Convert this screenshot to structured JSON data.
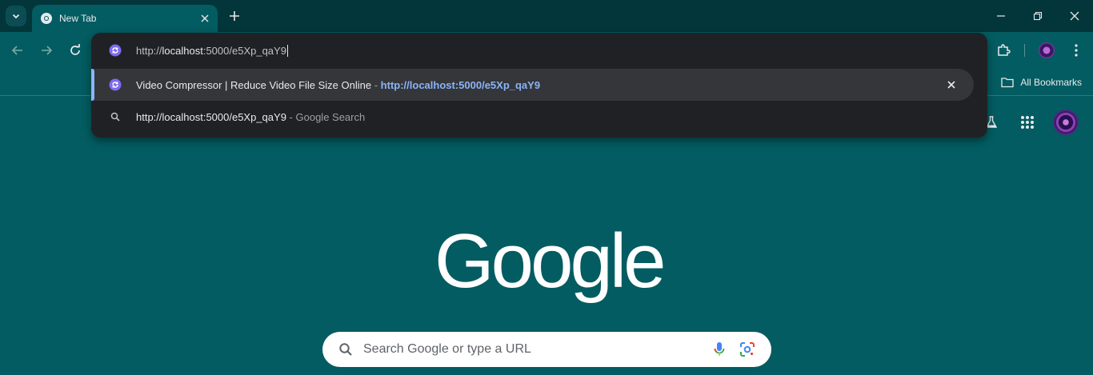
{
  "tab": {
    "title": "New Tab"
  },
  "omnibox": {
    "input_prefix": "http://",
    "input_host": "localhost",
    "input_rest": ":5000/e5Xp_qaY9",
    "suggestion_title": "Video Compressor | Reduce Video File Size Online",
    "suggestion_sep": " - ",
    "suggestion_url": "http://localhost:5000/e5Xp_qaY9",
    "search_query": "http://localhost:5000/e5Xp_qaY9",
    "search_sep": " - ",
    "search_suffix": "Google Search"
  },
  "bookmarks": {
    "all_label": "All Bookmarks"
  },
  "ntp": {
    "logo_text": "Google",
    "search_placeholder": "Search Google or type a URL"
  },
  "colors": {
    "background": "#035c61",
    "tabstrip": "#02363a",
    "omnibox_bg": "#202124",
    "selected_row": "#35363a",
    "accent_blue": "#8ab4f8"
  }
}
